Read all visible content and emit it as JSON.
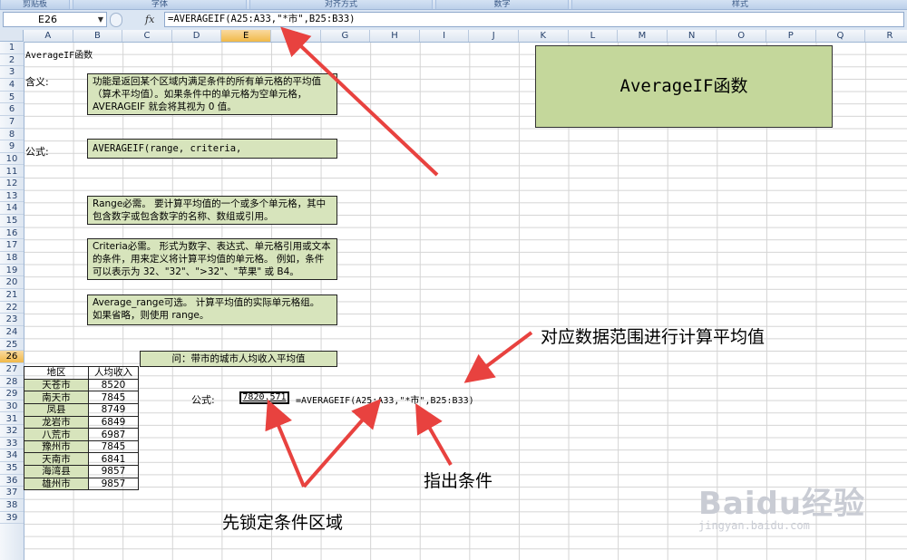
{
  "ribbon": {
    "groups": [
      "剪贴板",
      "字体",
      "对齐方式",
      "数字",
      "样式"
    ]
  },
  "formula_bar": {
    "name_box": "E26",
    "fx_label": "fx",
    "formula": "=AVERAGEIF(A25:A33,\"*市\",B25:B33)"
  },
  "columns": [
    "A",
    "B",
    "C",
    "D",
    "E",
    "F",
    "G",
    "H",
    "I",
    "J",
    "K",
    "L",
    "M",
    "N",
    "O",
    "P",
    "Q",
    "R"
  ],
  "selected_column": "E",
  "rows": [
    "1",
    "2",
    "3",
    "4",
    "5",
    "6",
    "7",
    "8",
    "9",
    "10",
    "11",
    "12",
    "13",
    "14",
    "15",
    "16",
    "17",
    "18",
    "19",
    "20",
    "21",
    "22",
    "23",
    "24",
    "25",
    "26",
    "27",
    "28",
    "29",
    "30",
    "31",
    "32",
    "33",
    "34",
    "35",
    "36",
    "37",
    "38",
    "39"
  ],
  "selected_row": "26",
  "sheet": {
    "a1": "AverageIF函数",
    "a3": "含义:",
    "a8": "公式:",
    "meaning": "功能是返回某个区域内满足条件的所有单元格的平均值（算术平均值）。如果条件中的单元格为空单元格，AVERAGEIF 就会将其视为 0 值。",
    "syntax": "AVERAGEIF(range, criteria, [average_range])",
    "range_desc": "Range必需。 要计算平均值的一个或多个单元格，其中包含数字或包含数字的名称、数组或引用。",
    "criteria_desc": "Criteria必需。 形式为数字、表达式、单元格引用或文本的条件，用来定义将计算平均值的单元格。 例如，条件可以表示为 32、\"32\"、\">32\"、\"苹果\" 或 B4。",
    "avg_range_desc": "Average_range可选。 计算平均值的实际单元格组。 如果省略，则使用 range。",
    "title_box": "AverageIF函数",
    "question": "问：带市的城市人均收入平均值",
    "formula_label": "公式:",
    "result": "7820.571",
    "formula_text": "=AVERAGEIF(A25:A33,\"*市\",B25:B33)"
  },
  "table": {
    "headers": [
      "地区",
      "人均收入"
    ],
    "rows": [
      [
        "天苍市",
        "8520"
      ],
      [
        "南天市",
        "7845"
      ],
      [
        "凤县",
        "8749"
      ],
      [
        "龙岩市",
        "6849"
      ],
      [
        "八荒市",
        "6987"
      ],
      [
        "豫州市",
        "7845"
      ],
      [
        "天南市",
        "6841"
      ],
      [
        "海湾县",
        "9857"
      ],
      [
        "雄州市",
        "9857"
      ]
    ]
  },
  "annotations": {
    "average_range_note": "对应数据范围进行计算平均值",
    "criteria_note": "指出条件",
    "lock_range_note": "先锁定条件区域"
  },
  "watermark": {
    "logo": "Baidu经验",
    "url": "jingyan.baidu.com"
  },
  "colors": {
    "arrow": "#e8423f",
    "note_fill": "#d7e4bc",
    "title_fill": "#c4d79b"
  }
}
